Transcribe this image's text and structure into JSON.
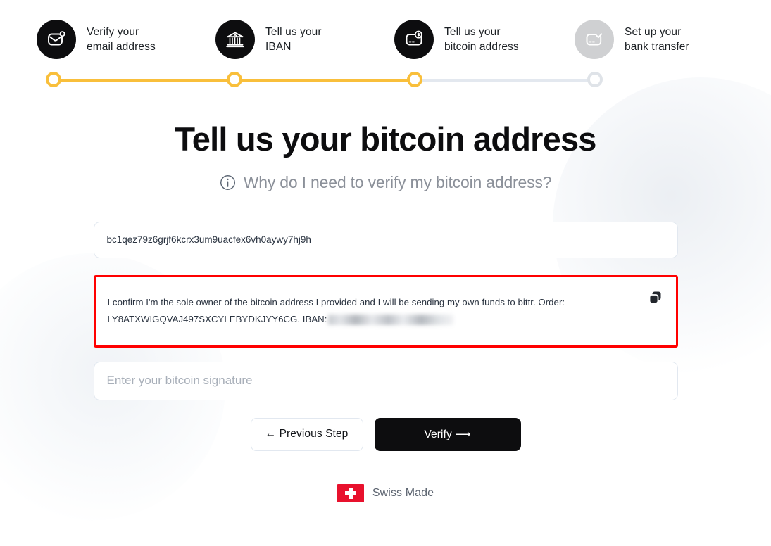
{
  "stepper": {
    "steps": [
      {
        "label": "Verify your\nemail address",
        "icon": "mail-icon",
        "state": "complete"
      },
      {
        "label": "Tell us your\nIBAN",
        "icon": "bank-icon",
        "state": "complete"
      },
      {
        "label": "Tell us your\nbitcoin address",
        "icon": "bitcoin-card-icon",
        "state": "current"
      },
      {
        "label": "Set up your\nbank transfer",
        "icon": "card-check-icon",
        "state": "upcoming"
      }
    ],
    "active_color": "#f9bf3b",
    "inactive_color": "#e3e8ef",
    "circle_active_color": "#0d0d0f",
    "circle_inactive_color": "#cfd0d2"
  },
  "heading": {
    "title": "Tell us your bitcoin address",
    "help_link": "Why do I need to verify my bitcoin address?",
    "help_icon": "info-icon"
  },
  "form": {
    "address_field": {
      "value": "bc1qez79z6grjf6kcrx3um9uacfex6vh0aywy7hj9h",
      "placeholder": "Enter your bitcoin address"
    },
    "message_box": {
      "text_before_iban": "I confirm I'm the sole owner of the bitcoin address I provided and I will be sending my own funds to bittr. Order: LY8ATXWIGQVAJ497SXCYLEBYDKJYY6CG. IBAN:",
      "iban_value": "",
      "iban_redacted": true,
      "copy_icon": "copy-icon",
      "highlight_color": "#ff0000"
    },
    "signature_field": {
      "value": "",
      "placeholder": "Enter your bitcoin signature"
    }
  },
  "actions": {
    "previous_label": "←  Previous Step",
    "verify_label": "Verify  ⟶"
  },
  "footer": {
    "text": "Swiss Made",
    "flag_icon": "swiss-flag-icon",
    "flag_color": "#e8112d"
  }
}
